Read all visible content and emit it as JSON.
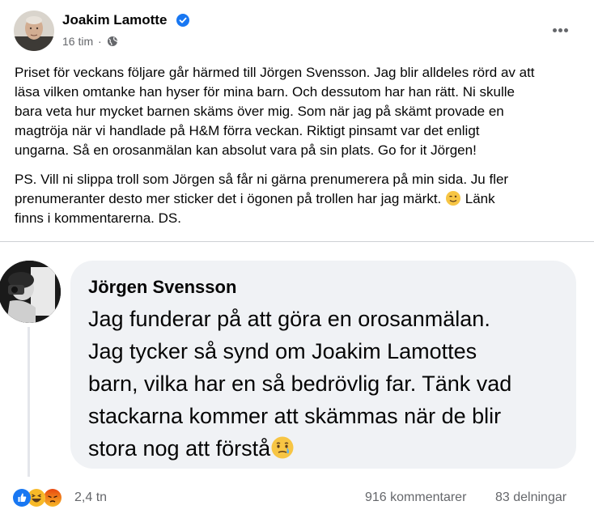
{
  "post": {
    "author_name": "Joakim Lamotte",
    "time": "16 tim",
    "dot": "·",
    "paragraph_1": [
      "Priset för veckans följare går härmed till Jörgen Svensson. Jag blir alldeles rörd av att",
      "läsa vilken omtanke han hyser för mina barn. Och dessutom har han rätt. Ni skulle",
      "bara veta hur mycket barnen skäms över mig. Som när jag på skämt provade en",
      "magtröja när vi handlade på H&M förra veckan. Riktigt pinsamt var det enligt",
      "ungarna. Så en orosanmälan kan absolut vara på sin plats. Go for it Jörgen!"
    ],
    "paragraph_2": [
      "PS. Vill ni slippa troll som Jörgen så får ni gärna prenumerera på min sida. Ju fler",
      "prenumeranter desto mer sticker det i ögonen på trollen har jag märkt.",
      "Länk",
      "finns  i kommentarerna. DS."
    ]
  },
  "comment": {
    "author_name": "Jörgen Svensson",
    "lines": [
      "Jag funderar på att göra en orosanmälan.",
      "Jag tycker så synd om Joakim Lamottes",
      "barn, vilka har en så bedrövlig far. Tänk vad",
      "stackarna kommer att skämmas när de blir",
      "stora nog att förstå"
    ]
  },
  "footer": {
    "reactions": [
      "like-icon",
      "haha-icon",
      "angry-icon"
    ],
    "reaction_count": "2,4 tn",
    "comments_count": "916 kommentarer",
    "shares_count": "83 delningar"
  },
  "colors": {
    "like": "#1877f2",
    "haha": "#f7b928",
    "angry": "#e9710f",
    "verified": "#1877f2",
    "secondary_text": "#65676b",
    "bubble": "#f0f2f5"
  }
}
